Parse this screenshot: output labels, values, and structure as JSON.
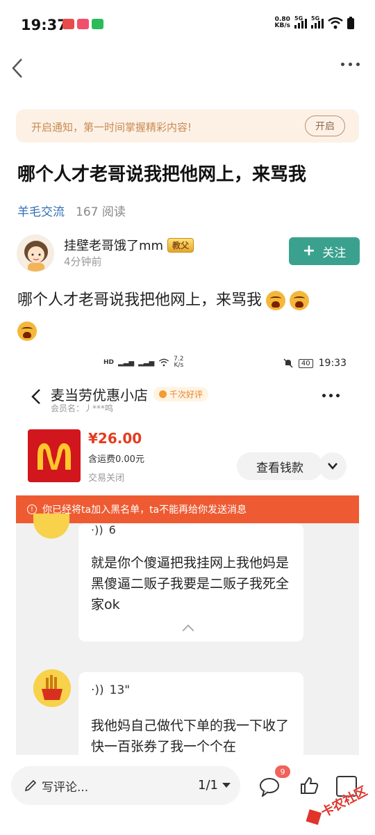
{
  "status_bar": {
    "time": "19:37",
    "net_speed_value": "0.80",
    "net_speed_unit": "KB/s",
    "sig1_label": "5G",
    "sig2_label": "5G"
  },
  "notify": {
    "text": "开启通知，第一时间掌握精彩内容!",
    "button": "开启"
  },
  "post": {
    "title": "哪个人才老哥说我把他网上，来骂我",
    "category": "羊毛交流",
    "reads": "167 阅读",
    "author_name": "挂壁老哥饿了mm",
    "author_badge": "教父",
    "time_ago": "4分钟前",
    "follow_label": "关注",
    "body": "哪个人才老哥说我把他网上，来骂我"
  },
  "screenshot": {
    "status_time": "19:33",
    "status_battery": "40",
    "status_speed_value": "7.2",
    "status_speed_unit": "K/s",
    "shop_name": "麦当劳优惠小店",
    "shop_tag": "千次好评",
    "member": "会员名：丿***鸣",
    "price": "¥26.00",
    "shipping": "含运费0.00元",
    "trade_state": "交易关闭",
    "view_button": "查看钱款",
    "warning": "你已经将ta加入黑名单，ta不能再给你发送消息",
    "voice1": "6",
    "message1": "就是你个傻逼把我挂网上我他妈是黑傻逼二贩子我要是二贩子我死全家ok",
    "voice2": "13\"",
    "message2": "我他妈自己做代下单的我一下收了快一百张券了我一个个在"
  },
  "bottom": {
    "comment_placeholder": "写评论...",
    "pager": "1/1",
    "comment_count": "9",
    "watermark": "卡农社区"
  },
  "colors": {
    "follow_green": "#3aa18e",
    "warning_orange": "#ee5b32",
    "price_red": "#e33c1f",
    "category_blue": "#2f6fb6"
  }
}
